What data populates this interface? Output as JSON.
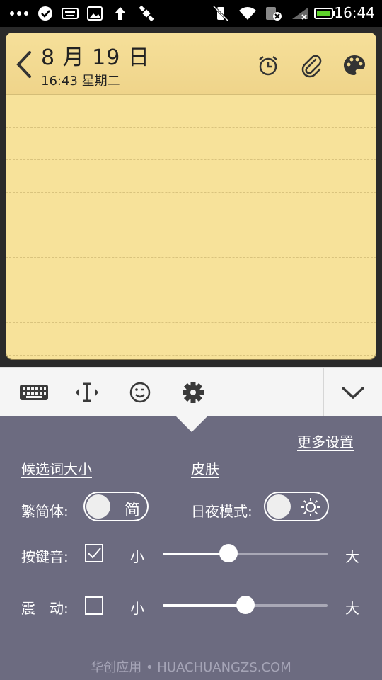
{
  "status_bar": {
    "time": "16:44",
    "icons": [
      "more-dots-icon",
      "check-circle-icon",
      "keyboard-icon",
      "image-icon",
      "upload-arrow-icon",
      "satellite-icon",
      "vibrate-off-icon",
      "wifi-icon",
      "sim-no-service-icon",
      "signal-icon",
      "battery-icon"
    ]
  },
  "note": {
    "date_title": "8 月 19 日",
    "date_subtitle": "16:43 星期二",
    "header_icons": [
      "alarm-clock-icon",
      "paperclip-icon",
      "palette-icon"
    ]
  },
  "toolbar": {
    "buttons": [
      "keyboard-icon",
      "cursor-move-icon",
      "emoji-icon",
      "settings-gear-icon",
      "collapse-chevron-icon"
    ]
  },
  "settings": {
    "more_settings": "更多设置",
    "candidate_size": "候选词大小",
    "skin": "皮肤",
    "traditional_simplified_label": "繁简体:",
    "traditional_simplified_glyph": "简",
    "day_night_label": "日夜模式:",
    "key_sound_label": "按键音:",
    "key_sound_checked": true,
    "small_label": "小",
    "large_label": "大",
    "key_sound_level": 0.4,
    "vibration_label": "震　动:",
    "vibration_checked": false,
    "vibration_level": 0.5,
    "colors": {
      "panel": "#6c6b80",
      "note": "#f7e29a"
    }
  },
  "watermark": "华创应用 • HUACHUANGZS.COM"
}
